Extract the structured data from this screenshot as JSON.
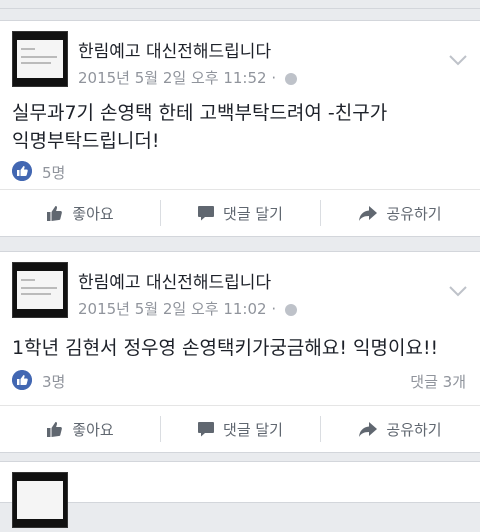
{
  "posts": [
    {
      "page_name": "한림예고 대신전해드립니다",
      "timestamp": "2015년 5월 2일 오후 11:52",
      "body_lines": [
        "실무과7기 손영택 한테 고백부탁드려여 -친구가",
        "익명부탁드립니더!"
      ],
      "like_count": "5명",
      "comment_count": ""
    },
    {
      "page_name": "한림예고 대신전해드립니다",
      "timestamp": "2015년 5월 2일 오후 11:02",
      "body_lines": [
        "1학년 김현서 정우영 손영택키가궁금해요! 익명이요!!"
      ],
      "like_count": "3명",
      "comment_count": "댓글 3개"
    }
  ],
  "actions": {
    "like": "좋아요",
    "comment": "댓글 달기",
    "share": "공유하기"
  },
  "icons": {
    "like": "thumbs-up-icon",
    "comment": "speech-bubble-icon",
    "share": "share-arrow-icon",
    "privacy": "globe-icon",
    "menu": "chevron-down-icon"
  },
  "colors": {
    "accent": "#4267b2",
    "muted": "#90949c",
    "background": "#e9ebee"
  }
}
